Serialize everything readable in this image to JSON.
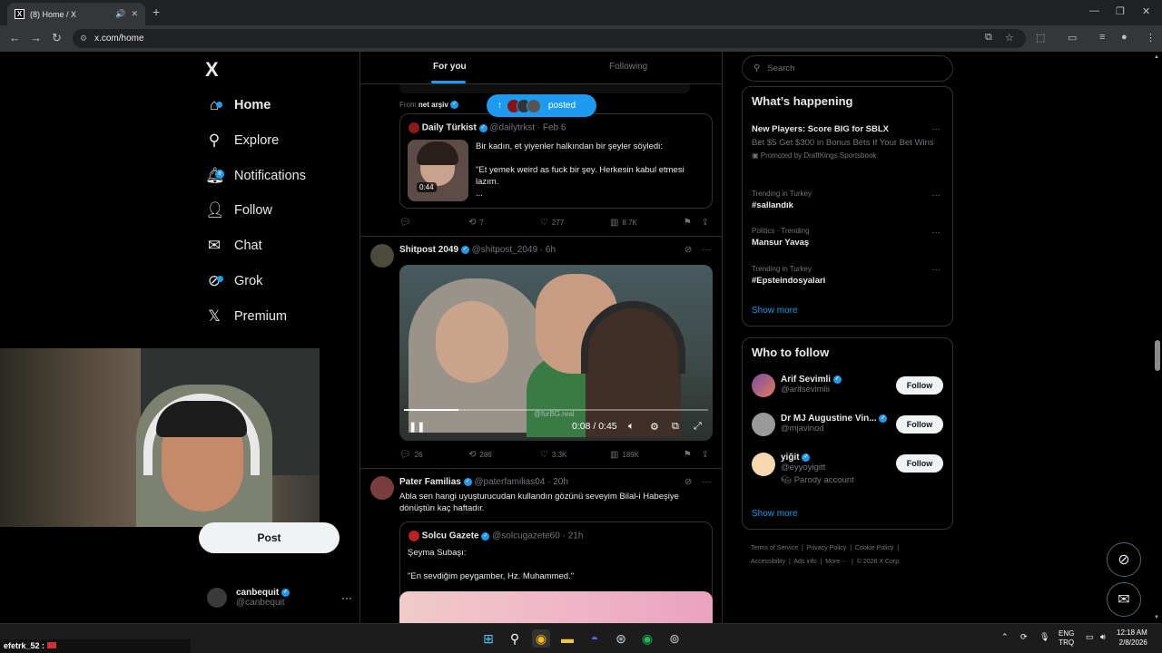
{
  "browser": {
    "tab_title": "(8) Home / X",
    "tab_favicon": "X",
    "url": "x.com/home"
  },
  "nav": {
    "logo": "X",
    "items": [
      {
        "label": "Home",
        "icon": "home-icon"
      },
      {
        "label": "Explore",
        "icon": "search-icon"
      },
      {
        "label": "Notifications",
        "icon": "bell-icon",
        "badge": "8"
      },
      {
        "label": "Follow",
        "icon": "person-add-icon"
      },
      {
        "label": "Chat",
        "icon": "mail-icon"
      },
      {
        "label": "Grok",
        "icon": "grok-icon"
      },
      {
        "label": "Premium",
        "icon": "x-icon"
      }
    ],
    "post_button": "Post",
    "account": {
      "name": "canbequit",
      "handle": "@canbequit"
    }
  },
  "feed": {
    "tabs": [
      "For you",
      "Following"
    ],
    "posted_pill": "posted",
    "post1": {
      "from_label": "From",
      "from_name": "net arşiv",
      "quote": {
        "name": "Daily Türkist",
        "handle": "@dailytrkst",
        "date": "· Feb 6",
        "duration": "0:44",
        "text1": "Bir kadın, et yiyenler halkından bir şeyler söyledi:",
        "text2": "\"Et yemek weird as fuck bir şey. Herkesin kabul etmesi lazım.",
        "text3": "..."
      },
      "reposts": "7",
      "likes": "277",
      "views": "8.7K"
    },
    "post2": {
      "name": "Shitpost 2049",
      "handle": "@shitpost_2049",
      "time": "· 6h",
      "video_time": "0:08 / 0:45",
      "watermark": "@furBG.real",
      "progress": 0.18,
      "replies": "26",
      "reposts": "286",
      "likes": "3.3K",
      "views": "189K"
    },
    "post3": {
      "name": "Pater Familias",
      "handle": "@paterfamilias04",
      "time": "· 20h",
      "text": "Abla sen hangi uyuşturucudan kullandın gözünü seveyim Bilal-i Habeşiye dönüştün kaç haftadır.",
      "quote": {
        "name": "Solcu Gazete",
        "handle": "@solcugazete60",
        "time": "· 21h",
        "text1": "Şeyma Subaşı:",
        "text2": "\"En sevdiğim peygamber, Hz. Muhammed.\""
      }
    }
  },
  "sidebar": {
    "search_placeholder": "Search",
    "happening": {
      "title": "What’s happening",
      "trends": [
        {
          "category": "",
          "name": "New Players: Score BIG for SBLX",
          "desc": "Bet $5 Get $300 in Bonus Bets If Your Bet Wins",
          "promo": "Promoted by DraftKings Sportsbook"
        },
        {
          "category": "Trending in Turkey",
          "name": "#sallandık"
        },
        {
          "category": "Politics · Trending",
          "name": "Mansur Yavaş"
        },
        {
          "category": "Trending in Turkey",
          "name": "#Epsteindosyalari"
        }
      ],
      "show_more": "Show more"
    },
    "who_to_follow": {
      "title": "Who to follow",
      "users": [
        {
          "name": "Arif Sevimli",
          "handle": "@arifsevimlii",
          "button": "Follow"
        },
        {
          "name": "Dr MJ Augustine Vin...",
          "handle": "@mjavinod",
          "button": "Follow"
        },
        {
          "name": "yiğit",
          "handle": "@eyyoyigitt",
          "note": "Parody account",
          "button": "Follow"
        }
      ],
      "show_more": "Show more"
    },
    "footer": {
      "links1": [
        "Terms of Service",
        "Privacy Policy",
        "Cookie Policy"
      ],
      "links2": [
        "Accessibility",
        "Ads info",
        "More ···",
        "© 2026 X Corp."
      ]
    }
  },
  "overlay": {
    "chat_user": "efetrk_52 :"
  },
  "taskbar": {
    "lang1": "ENG",
    "lang2": "TRQ",
    "time": "12:18 AM",
    "date": "2/8/2026"
  },
  "colors": {
    "accent": "#1d9bf0",
    "bg": "#000000",
    "border": "#2f3336",
    "muted": "#71767b"
  }
}
